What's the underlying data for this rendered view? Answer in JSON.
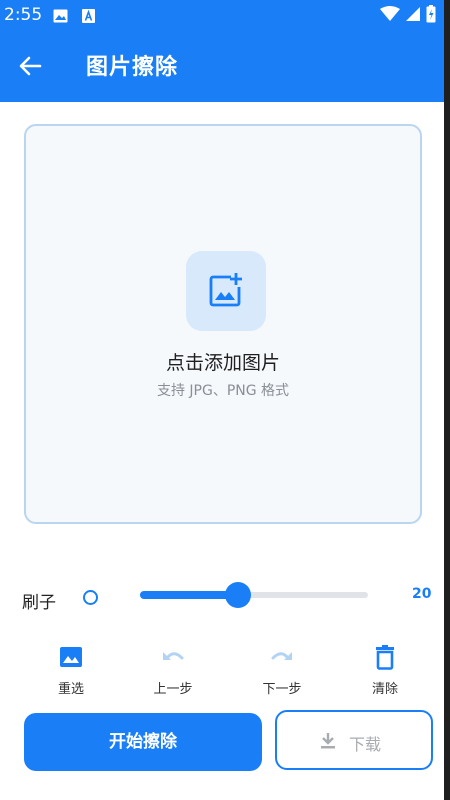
{
  "status_bar": {
    "time": "2:55",
    "notification_icons": [
      "image-icon",
      "font-a-icon"
    ],
    "system_icons": [
      "wifi-icon",
      "cellular-icon",
      "battery-icon"
    ]
  },
  "app_bar": {
    "title": "图片擦除",
    "back_icon": "arrow-left-icon",
    "color": "#1a7ff6"
  },
  "upload": {
    "title": "点击添加图片",
    "hint": "支持 JPG、PNG 格式",
    "icon": "add-photo-icon"
  },
  "brush": {
    "label": "刷子",
    "value": "20",
    "slider_fraction": 0.43
  },
  "tools": [
    {
      "label": "重选",
      "icon": "image-icon",
      "enabled": true
    },
    {
      "label": "上一步",
      "icon": "undo-icon",
      "enabled": false
    },
    {
      "label": "下一步",
      "icon": "redo-icon",
      "enabled": false
    },
    {
      "label": "清除",
      "icon": "trash-icon",
      "enabled": true
    }
  ],
  "actions": {
    "start_label": "开始擦除",
    "download_label": "下载",
    "download_icon": "download-icon"
  },
  "colors": {
    "accent": "#1a7ff6",
    "disabled": "#b3d3f5",
    "upload_border": "#b9d5ef"
  }
}
